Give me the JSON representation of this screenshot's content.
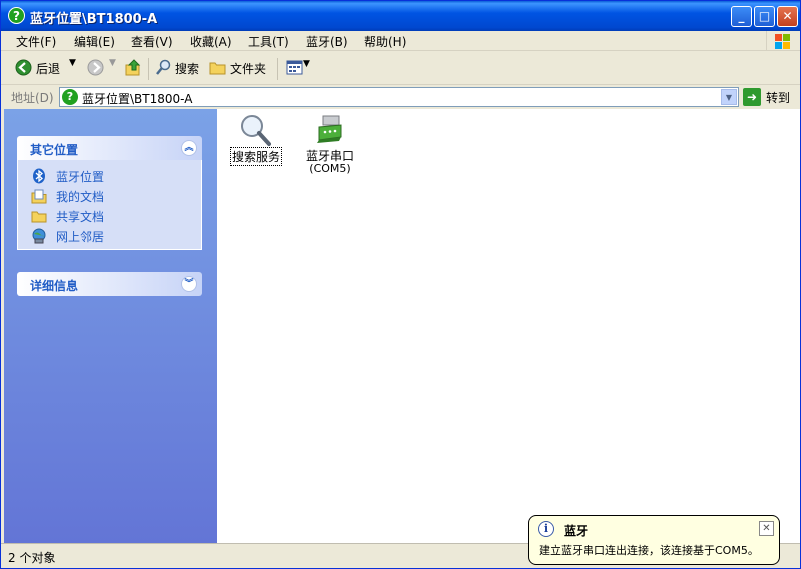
{
  "window": {
    "title": "蓝牙位置\\BT1800-A",
    "minimize_label": "_",
    "maximize_label": "□",
    "close_label": "✕"
  },
  "menu": {
    "items": [
      "文件(F)",
      "编辑(E)",
      "查看(V)",
      "收藏(A)",
      "工具(T)",
      "蓝牙(B)",
      "帮助(H)"
    ]
  },
  "toolbar": {
    "back_label": "后退",
    "search_label": "搜索",
    "folders_label": "文件夹"
  },
  "address": {
    "label": "地址(D)",
    "value": "蓝牙位置\\BT1800-A",
    "go_label": "转到"
  },
  "sidebar": {
    "other_places": {
      "title": "其它位置",
      "items": [
        {
          "label": "蓝牙位置",
          "icon": "bluetooth-icon"
        },
        {
          "label": "我的文档",
          "icon": "documents-icon"
        },
        {
          "label": "共享文档",
          "icon": "shared-folder-icon"
        },
        {
          "label": "网上邻居",
          "icon": "network-icon"
        }
      ]
    },
    "details": {
      "title": "详细信息"
    }
  },
  "content": {
    "items": [
      {
        "label": "搜索服务",
        "icon": "magnifier-icon"
      },
      {
        "label": "蓝牙串口",
        "sublabel": "(COM5)",
        "icon": "serial-port-icon"
      }
    ]
  },
  "status": {
    "text": "2 个对象"
  },
  "balloon": {
    "title": "蓝牙",
    "message": "建立蓝牙串口连出连接，该连接基于COM5。"
  },
  "colors": {
    "titlebar": "#0054e3",
    "sidebar_gradient_top": "#7ba2e7",
    "sidebar_link": "#215dc6",
    "balloon_bg": "#ffffe1"
  }
}
